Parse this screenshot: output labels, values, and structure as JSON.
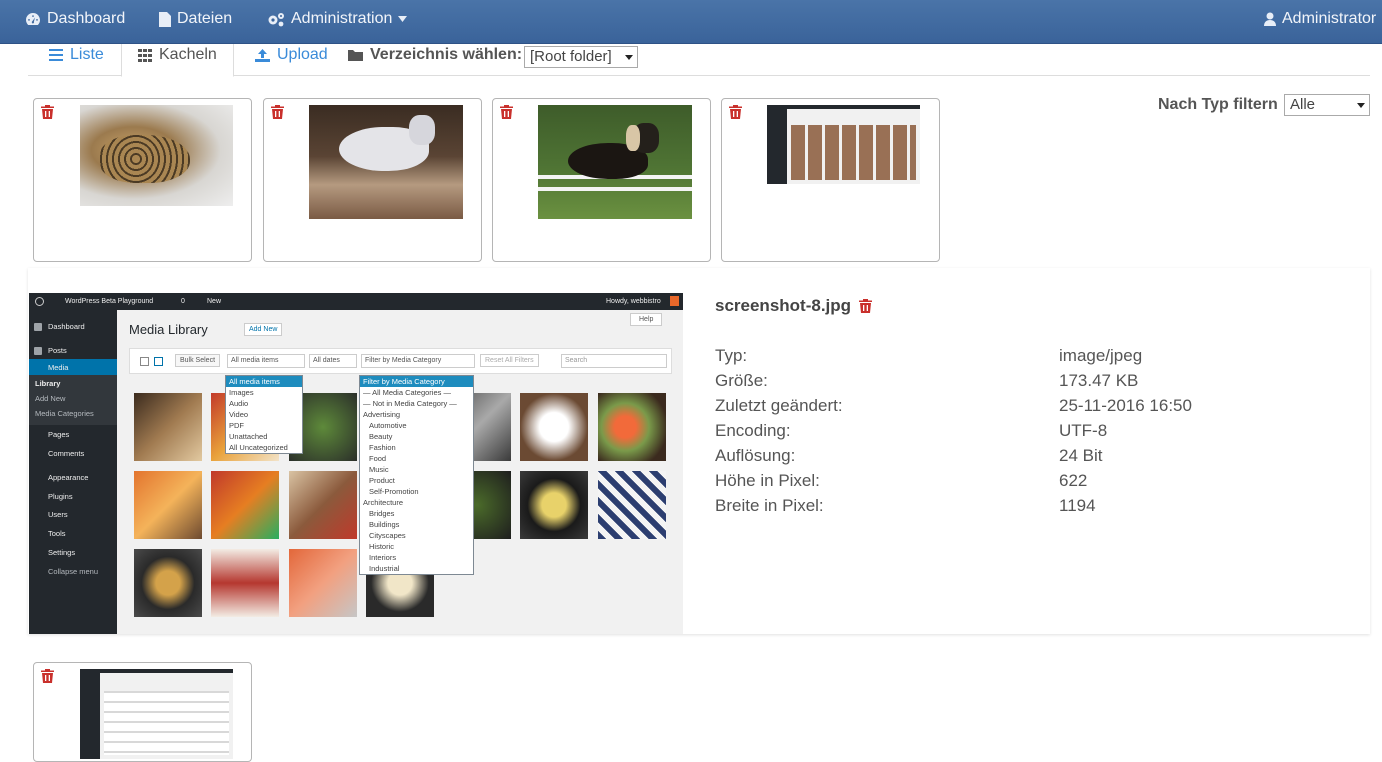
{
  "navbar": {
    "dashboard": "Dashboard",
    "files": "Dateien",
    "administration": "Administration",
    "user": "Administrator"
  },
  "tabs": {
    "list": "Liste",
    "tiles": "Kacheln",
    "upload": "Upload"
  },
  "directory": {
    "label": "Verzeichnis wählen:",
    "value": "[Root folder]"
  },
  "type_filter": {
    "label": "Nach Typ filtern",
    "value": "Alle"
  },
  "detail": {
    "filename": "screenshot-8.jpg",
    "properties": [
      {
        "key": "Typ:",
        "value": "image/jpeg"
      },
      {
        "key": "Größe:",
        "value": "173.47 KB"
      },
      {
        "key": "Zuletzt geändert:",
        "value": "25-11-2016 16:50"
      },
      {
        "key": "Encoding:",
        "value": "UTF-8"
      },
      {
        "key": "Auflösung:",
        "value": "24 Bit"
      },
      {
        "key": "Höhe in Pixel:",
        "value": "622"
      },
      {
        "key": "Breite in Pixel:",
        "value": "1194"
      }
    ]
  },
  "preview": {
    "site": "WordPress Beta Playground",
    "comments": "0",
    "new": "New",
    "howdy": "Howdy, webbistro",
    "help": "Help",
    "page_title": "Media Library",
    "add_new": "Add New",
    "bulk_select": "Bulk Select",
    "media_filter": "All media items",
    "dates": "All dates",
    "category_filter": "Filter by Media Category",
    "reset": "Reset All Filters",
    "search": "Search",
    "sidebar": [
      "Dashboard",
      "Posts",
      "Media",
      "Library",
      "Add New",
      "Media Categories",
      "Pages",
      "Comments",
      "Appearance",
      "Plugins",
      "Users",
      "Tools",
      "Settings",
      "Collapse menu"
    ],
    "media_options": [
      "All media items",
      "Images",
      "Audio",
      "Video",
      "PDF",
      "Unattached",
      "All Uncategorized"
    ],
    "category_options": [
      "Filter by Media Category",
      "— All Media Categories —",
      "— Not in Media Category —",
      "Advertising",
      "Automotive",
      "Beauty",
      "Fashion",
      "Food",
      "Music",
      "Product",
      "Self-Promotion",
      "Architecture",
      "Bridges",
      "Buildings",
      "Cityscapes",
      "Historic",
      "Interiors",
      "Industrial"
    ]
  }
}
